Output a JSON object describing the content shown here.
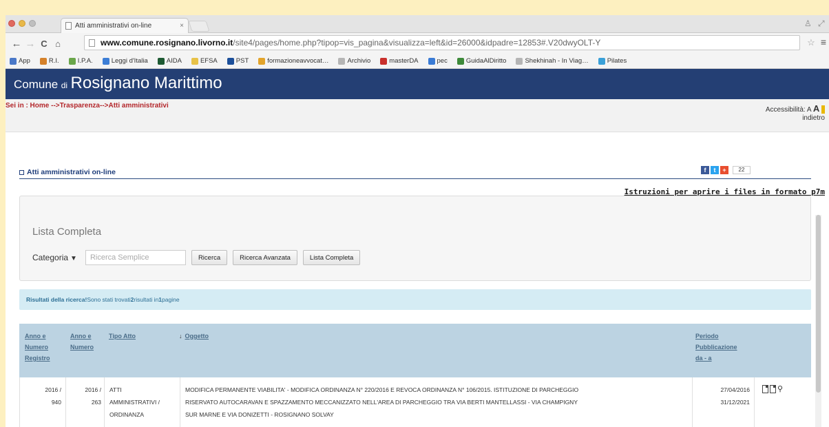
{
  "browser": {
    "tab_title": "Atti amministrativi on-line",
    "tab_close": "×",
    "url_host": "www.comune.rosignano.livorno.it",
    "url_path": "/site4/pages/home.php?tipop=vis_pagina&visualizza=left&id=26000&idpadre=12853#.V20dwyOLT-Y",
    "bookmarks": [
      {
        "label": "App",
        "color": "#4a78c8"
      },
      {
        "label": "R.I.",
        "color": "#d5812a"
      },
      {
        "label": "I.P.A.",
        "color": "#6aa64a"
      },
      {
        "label": "Leggi d'Italia",
        "color": "#3d7ed6"
      },
      {
        "label": "AIDA",
        "color": "#1e5a33"
      },
      {
        "label": "EFSA",
        "color": "#e8c248"
      },
      {
        "label": "PST",
        "color": "#1c4f9a"
      },
      {
        "label": "formazioneavvocat…",
        "color": "#e3a42b"
      },
      {
        "label": "Archivio",
        "color": "#b5b5b5"
      },
      {
        "label": "masterDA",
        "color": "#c9302c"
      },
      {
        "label": "pec",
        "color": "#3a7bd5"
      },
      {
        "label": "GuidaAlDiritto",
        "color": "#3e8a3a"
      },
      {
        "label": "Shekhinah - In Viag…",
        "color": "#b5b5b5"
      },
      {
        "label": "Pilates",
        "color": "#3aa0d8"
      }
    ]
  },
  "site": {
    "title_a": "Comune",
    "title_b": "di",
    "title_c": "Rosignano Marittimo",
    "breadcrumb": "Sei in : Home -->Trasparenza-->Atti amministrativi",
    "accessibility_label": "Accessibilità:",
    "accessibility_small": "A",
    "accessibility_big": "A",
    "back_link": "indietro"
  },
  "page": {
    "section_title": "Atti amministrativi on-line",
    "share_count": "22",
    "p7m_link": "Istruzioni per aprire i files in formato p7m"
  },
  "search": {
    "heading": "Lista Completa",
    "category_label": "Categoria",
    "input_placeholder": "Ricerca Semplice",
    "btn_search": "Ricerca",
    "btn_advanced": "Ricerca Avanzata",
    "btn_full_list": "Lista Completa"
  },
  "results": {
    "lead": "Risultati della ricerca!",
    "text_before": " Sono stati trovati ",
    "count": "2",
    "text_middle": " risultati in ",
    "pages": "1",
    "text_after": " pagine"
  },
  "table": {
    "headers": {
      "col1": [
        "Anno e",
        "Numero",
        "Registro"
      ],
      "col2": [
        "Anno e",
        "Numero"
      ],
      "col3": "Tipo Atto",
      "col4": "Oggetto",
      "col5": [
        "Periodo",
        "Pubblicazione",
        "da - a"
      ]
    },
    "rows": [
      {
        "registro": [
          "2016 /",
          "940"
        ],
        "numero": [
          "2016 /",
          "263"
        ],
        "tipo": [
          "ATTI",
          "AMMINISTRATIVI /",
          "ORDINANZA"
        ],
        "oggetto": [
          "MODIFICA PERMANENTE VIABILITA' - MODIFICA ORDINANZA N° 220/2016 E REVOCA ORDINANZA N° 106/2015. ISTITUZIONE DI PARCHEGGIO",
          "RISERVATO AUTOCARAVAN E SPAZZAMENTO MECCANIZZATO NELL'AREA DI PARCHEGGIO TRA VIA BERTI MANTELLASSI - VIA CHAMPIGNY",
          "SUR MARNE E VIA DONIZETTI - ROSIGNANO SOLVAY"
        ],
        "periodo": [
          "27/04/2016",
          "31/12/2021"
        ]
      }
    ]
  },
  "colors": {
    "header_bg": "#243f74",
    "breadcrumb_red": "#b3262a",
    "results_bg": "#d5ecf4",
    "table_head_bg": "#bcd3e2"
  }
}
